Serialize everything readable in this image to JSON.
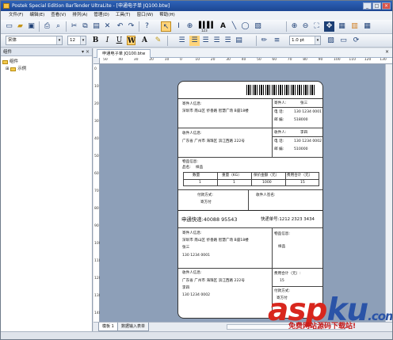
{
  "window": {
    "title": "Postek Special Edition BarTender UltraLite - [申通电子单 JQ100.btw]",
    "controls": [
      "_",
      "□",
      "×"
    ]
  },
  "menu": [
    "文件(F)",
    "编辑(E)",
    "查看(V)",
    "排列(A)",
    "管理(D)",
    "工具(T)",
    "窗口(W)",
    "帮助(H)"
  ],
  "toolbar": {
    "font_name": "宋体",
    "font_size": "12",
    "font_size_2": "1.0 pt",
    "bold": "B",
    "italic": "I",
    "underline": "U",
    "wrap": "W",
    "color": "A",
    "barcode_caption": "123"
  },
  "panel": {
    "title": "组件",
    "tree": [
      "组件",
      "示例"
    ],
    "controls": "▾ ×"
  },
  "doc_tab": {
    "label": "申通电子单 JQ100.btw",
    "close": "×"
  },
  "ruler": {
    "h": [
      "50",
      "40",
      "30",
      "20",
      "10",
      "0",
      "10",
      "20",
      "30",
      "40",
      "50",
      "60",
      "70",
      "80",
      "90",
      "100",
      "110",
      "120",
      "130"
    ],
    "v": [
      "0",
      "10",
      "20",
      "30",
      "40",
      "50",
      "60",
      "70",
      "80",
      "90",
      "100",
      "110",
      "120",
      "130",
      "140"
    ]
  },
  "sheet_tabs": [
    "模板 1",
    "数据输入表单"
  ],
  "label": {
    "sender_title": "寄件人信息:",
    "sender_addr": "深圳市  南山区  侨香路  智慧广场  B座18楼",
    "sender_name_label": "寄件人:",
    "sender_name": "张三",
    "sender_phone_label": "电  话:",
    "sender_phone": "130 1234 0001",
    "sender_zip_label": "邮  编:",
    "sender_zip": "518000",
    "recv_title": "收件人信息:",
    "recv_addr": "广东省   广州市   海珠区   滨江西路   222号",
    "recv_name_label": "收件人:",
    "recv_name": "李四",
    "recv_phone_label": "电  话:",
    "recv_phone": "130 1234 0002",
    "recv_zip_label": "邮  编:",
    "recv_zip": "510000",
    "goods_title": "物品信息:",
    "goods_name_label": "品名:",
    "goods_name": "样品",
    "table_headers": [
      "数量",
      "重量（KG）",
      "保价金额（元）",
      "费用合计（元）"
    ],
    "table_values": [
      "1",
      "1",
      "1000",
      "15"
    ],
    "pay_label": "付款方式:",
    "pay_value": "寄方付",
    "recv_sign": "收件人签名:",
    "company": "申通快递:40088 95543",
    "tracking": "快递单号:1212 2323 3434",
    "s2_sender_title": "寄件人信息:",
    "s2_sender_addr": "深圳市  南山区  侨香路  智慧广场  B座18楼",
    "s2_sender_name": "张三",
    "s2_sender_phone": "130 1234 0001",
    "s2_goods_title": "物品信息:",
    "s2_goods_name": "样品",
    "s2_recv_title": "收件人信息:",
    "s2_recv_addr": "广东省   广州市   海珠区   滨江西路   222号",
    "s2_recv_name": "李四",
    "s2_recv_phone": "130 1234 0002",
    "s2_fee_label": "费用合计（元）:",
    "s2_fee": "15",
    "s2_pay_label": "付款方式:",
    "s2_pay": "寄方付"
  },
  "watermark": {
    "brand_a": "asp",
    "brand_b": "ku",
    "brand_c": ".com",
    "tagline": "免费网站源码下载站!"
  },
  "colors": {
    "title_bar": "#1c4592",
    "canvas": "#8d9fb8",
    "brand_red": "#d8261d",
    "brand_blue": "#2a53a7"
  }
}
